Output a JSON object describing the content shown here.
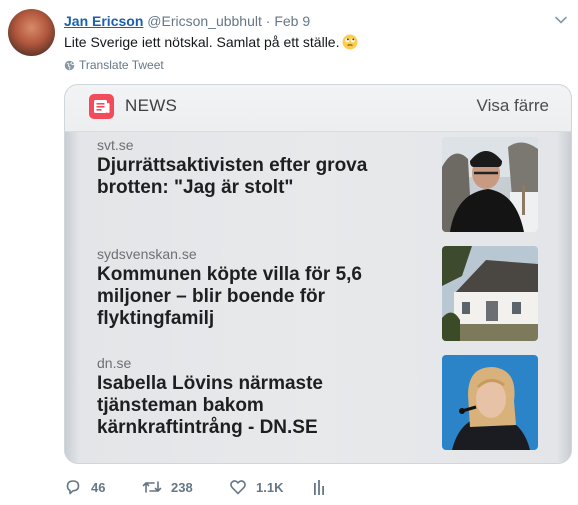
{
  "tweet": {
    "author_name": "Jan Ericson",
    "handle": "@Ericson_ubbhult",
    "separator": "·",
    "date": "Feb 9",
    "text": "Lite Sverige iett nötskal. Samlat på ett ställe.",
    "emoji": "face-with-rolling-eyes-emoji",
    "translate_label": "Translate Tweet"
  },
  "card": {
    "app_name": "NEWS",
    "show_less": "Visa färre",
    "items": [
      {
        "source": "svt.se",
        "headline": "Djurrättsaktivisten efter grova brotten: \"Jag är stolt\"",
        "thumb": "man-in-winter-hat-photo"
      },
      {
        "source": "sydsvenskan.se",
        "headline": "Kommunen köpte villa för 5,6 miljoner – blir boende för flyktingfamilj",
        "thumb": "white-villa-photo"
      },
      {
        "source": "dn.se",
        "headline": "Isabella Lövins närmaste tjänsteman bakom kärnkraftintrång - DN.SE",
        "thumb": "woman-at-microphone-photo"
      }
    ]
  },
  "actions": {
    "replies": "46",
    "retweets": "238",
    "likes": "1.1K"
  },
  "colors": {
    "link": "#1b5fae",
    "muted": "#657786",
    "news_red": "#f24b5c"
  }
}
